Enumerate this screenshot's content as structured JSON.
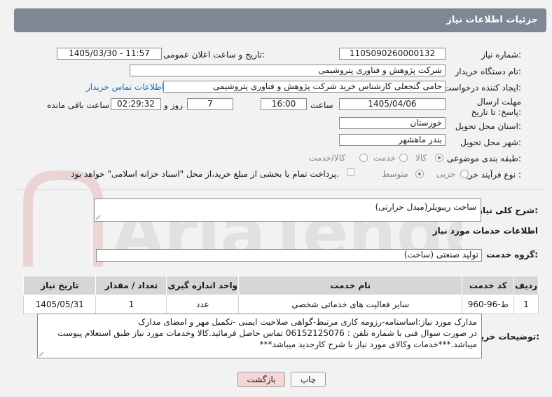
{
  "header": {
    "title": "جزئیات اطلاعات نیاز"
  },
  "form": {
    "need_number_label": "شماره نیاز:",
    "need_number": "1105090260000132",
    "announce_label": "تاریخ و ساعت اعلان عمومی:",
    "announce_value": "1405/03/30 - 11:57",
    "buyer_org_label": "نام دستگاه خریدار:",
    "buyer_org": "شرکت پژوهش و فناوری پتروشیمی",
    "creator_label": "ایجاد کننده درخواست:",
    "creator": "حامی گنجعلی کارشناس خرید شرکت پژوهش و فناوری پتروشیمی",
    "contact_link": "اطلاعات تماس خریدار",
    "deadline_label": "مهلت ارسال پاسخ: تا تاریخ:",
    "deadline_date": "1405/04/06",
    "time_label": "ساعت",
    "deadline_time": "16:00",
    "days_value": "7",
    "days_label": "روز و",
    "remaining_time": "02:29:32",
    "remaining_label": "ساعت باقی مانده",
    "province_label": "استان محل تحویل:",
    "province": "خوزستان",
    "city_label": "شهر محل تحویل:",
    "city": "بندر ماهشهر",
    "category_label": "طبقه بندی موضوعی:",
    "category_options": [
      "کالا",
      "خدمت",
      "کالا/خدمت"
    ],
    "process_label": "نوع فرآیند خرید :",
    "process_options": [
      "جزیی",
      "متوسط"
    ],
    "payment_note": "پرداخت تمام یا بخشی از مبلغ خرید،از محل \"اسناد خزانه اسلامی\" خواهد بود."
  },
  "summary": {
    "label": "شرح کلی نیاز:",
    "value": "ساخت ریبویلر(مبدل حرارتی)"
  },
  "services_section": {
    "title": "اطلاعات خدمات مورد نیاز"
  },
  "service_group": {
    "label": "گروه خدمت:",
    "value": "تولید صنعتی (ساخت)"
  },
  "table": {
    "headers": [
      "ردیف",
      "کد خدمت",
      "نام خدمت",
      "واحد اندازه گیری",
      "تعداد / مقدار",
      "تاریخ نیاز"
    ],
    "rows": [
      [
        "1",
        "ط-96-960",
        "سایر فعالیت های خدماتی شخصی",
        "عدد",
        "1",
        "1405/05/31"
      ]
    ]
  },
  "buyer_notes": {
    "label": "توضیحات خریدار:",
    "line1": "مدارک مورد نیاز:اساسنامه-رزومه کاری مرتبط-گواهی صلاحیت ایمنی -تکمیل مهر و امضای مدارک",
    "line2": "در صورت سوال فنی با شماره تلفن : 06152125076 تماس حاصل فرمائید.کالا وخدمات مورد نیاز طبق استعلام پیوست",
    "line3": "میباشد.***خدمات وکالای مورد نیاز با شرح کارجدید میباشد***"
  },
  "buttons": {
    "print": "چاپ",
    "back": "بازگشت"
  },
  "watermark": {
    "text": "AriaTender.net"
  },
  "colors": {
    "header_bg": "#7d8894",
    "back_btn_bg": "#f6d6d6",
    "link": "#1f6fc7"
  }
}
